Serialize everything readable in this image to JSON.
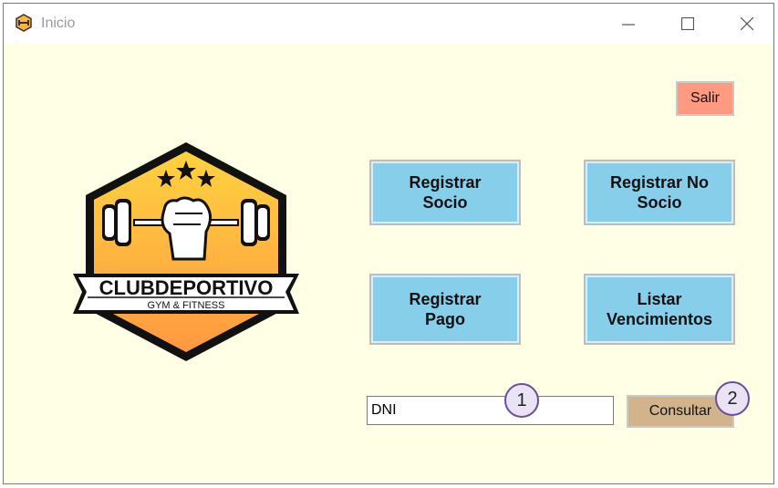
{
  "window": {
    "title": "Inicio",
    "icon": "gym-logo-icon",
    "controls": [
      "minimize-icon",
      "maximize-icon",
      "close-icon"
    ]
  },
  "logo": {
    "brand": "CLUBDEPORTIVO",
    "tagline": "GYM & FITNESS",
    "colors": {
      "gradient_top": "#ffd23f",
      "gradient_bottom": "#ff9940",
      "outline": "#111111"
    }
  },
  "buttons": {
    "salir": "Salir",
    "registrar_socio": "Registrar\nSocio",
    "registrar_no_socio": "Registrar No\nSocio",
    "registrar_pago": "Registrar\nPago",
    "listar_vencimientos": "Listar\nVencimientos",
    "consultar": "Consultar"
  },
  "dni_input": {
    "value": "DNI"
  },
  "annotations": [
    "1",
    "2"
  ],
  "colors": {
    "background": "#ffffe6",
    "button_blue": "#87ceeb",
    "button_salir": "#ff9a80",
    "button_consultar": "#d2b48c",
    "badge_border": "#6b4d99"
  }
}
